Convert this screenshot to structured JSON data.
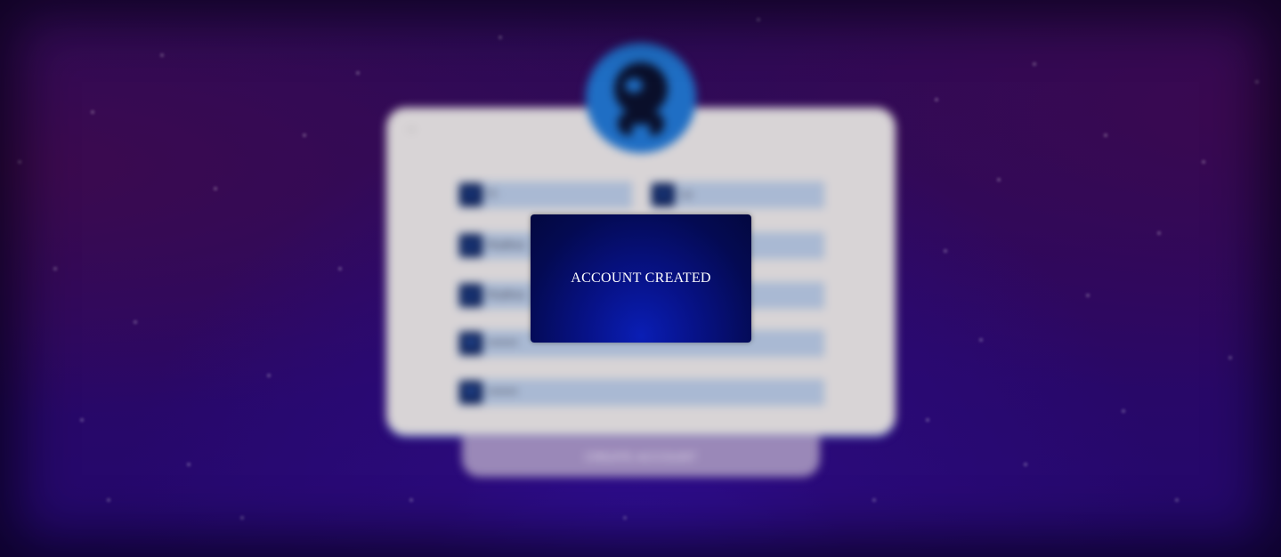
{
  "colors": {
    "background": "#2a0865",
    "card": "#d8d4d6",
    "avatar": "#1f6ec4",
    "field": "#a9b9d3",
    "field_icon": "#0b1f57",
    "button": "#9a88b8",
    "modal": "#040a52"
  },
  "form": {
    "back_icon": "arrow-left-icon",
    "avatar_icon": "robot-avatar-icon",
    "first_name_placeholder": "Fi",
    "last_name_placeholder": "La",
    "email_placeholder": "Rudhva",
    "confirm_email_placeholder": "Rudhva",
    "password_value": "••••••••",
    "confirm_password_value": "••••••••",
    "create_button_label": "CREATE ACCOUNT"
  },
  "modal": {
    "message": "ACCOUNT CREATED"
  }
}
